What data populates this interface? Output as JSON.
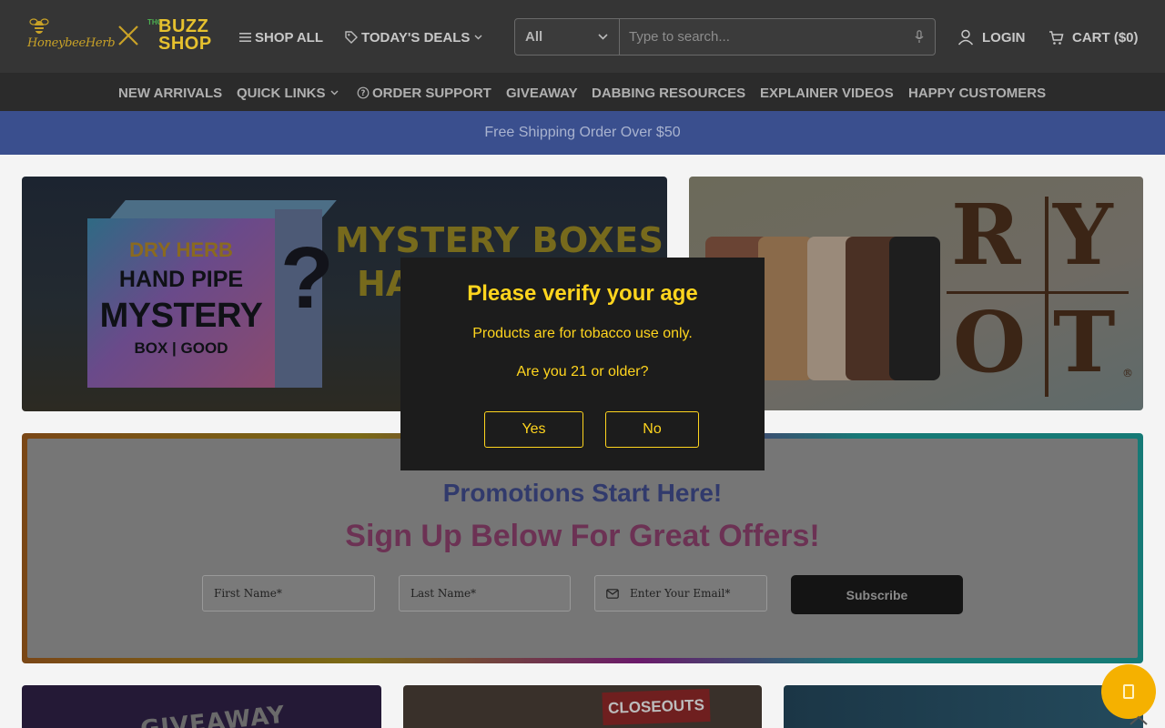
{
  "header": {
    "logo_script": "HoneybeeHerb",
    "logo_buzz_top": "BUZZ",
    "logo_buzz_bottom": "SHOP",
    "logo_thc": "THC",
    "nav": [
      {
        "label": "SHOP ALL",
        "icon": "hamburger-icon"
      },
      {
        "label": "TODAY'S DEALS",
        "icon": "tag-icon",
        "dropdown": true
      }
    ],
    "search": {
      "category": "All",
      "placeholder": "Type to search..."
    },
    "login_label": "LOGIN",
    "cart_label": "CART ($0)"
  },
  "subnav": [
    {
      "label": "NEW ARRIVALS"
    },
    {
      "label": "QUICK LINKS",
      "dropdown": true
    },
    {
      "label": "ORDER SUPPORT",
      "icon": "question-circle-icon"
    },
    {
      "label": "GIVEAWAY"
    },
    {
      "label": "DABBING RESOURCES"
    },
    {
      "label": "EXPLAINER VIDEOS"
    },
    {
      "label": "HAPPY CUSTOMERS"
    }
  ],
  "promo_bar": "Free Shipping Order Over $50",
  "banners": {
    "mystery": {
      "box_line1": "DRY HERB",
      "box_line2": "HAND PIPE",
      "box_line3": "MYSTERY",
      "box_line4": "BOX | GOOD",
      "title": "MYSTERY BOXES",
      "subtitle": "HA"
    },
    "ryot": {
      "letters": [
        "R",
        "Y",
        "O",
        "T"
      ],
      "registered": "®"
    }
  },
  "signup": {
    "heading": "Promotions Start Here!",
    "subheading": "Sign Up Below For Great Offers!",
    "first_name_placeholder": "First Name*",
    "last_name_placeholder": "Last Name*",
    "email_placeholder": "Enter Your Email*",
    "subscribe_label": "Subscribe"
  },
  "cards": {
    "giveaway_text": "GIVEAWAY",
    "closeouts_text": "CLOSEOUTS"
  },
  "modal": {
    "title": "Please verify your age",
    "text1": "Products are for tobacco use only.",
    "text2": "Are you 21 or older?",
    "yes_label": "Yes",
    "no_label": "No"
  },
  "colors": {
    "modal_accent": "#ffd51e",
    "header_bg": "#353535",
    "promo_bar_bg": "#3a4f8e",
    "chat_button": "#f5b100"
  }
}
